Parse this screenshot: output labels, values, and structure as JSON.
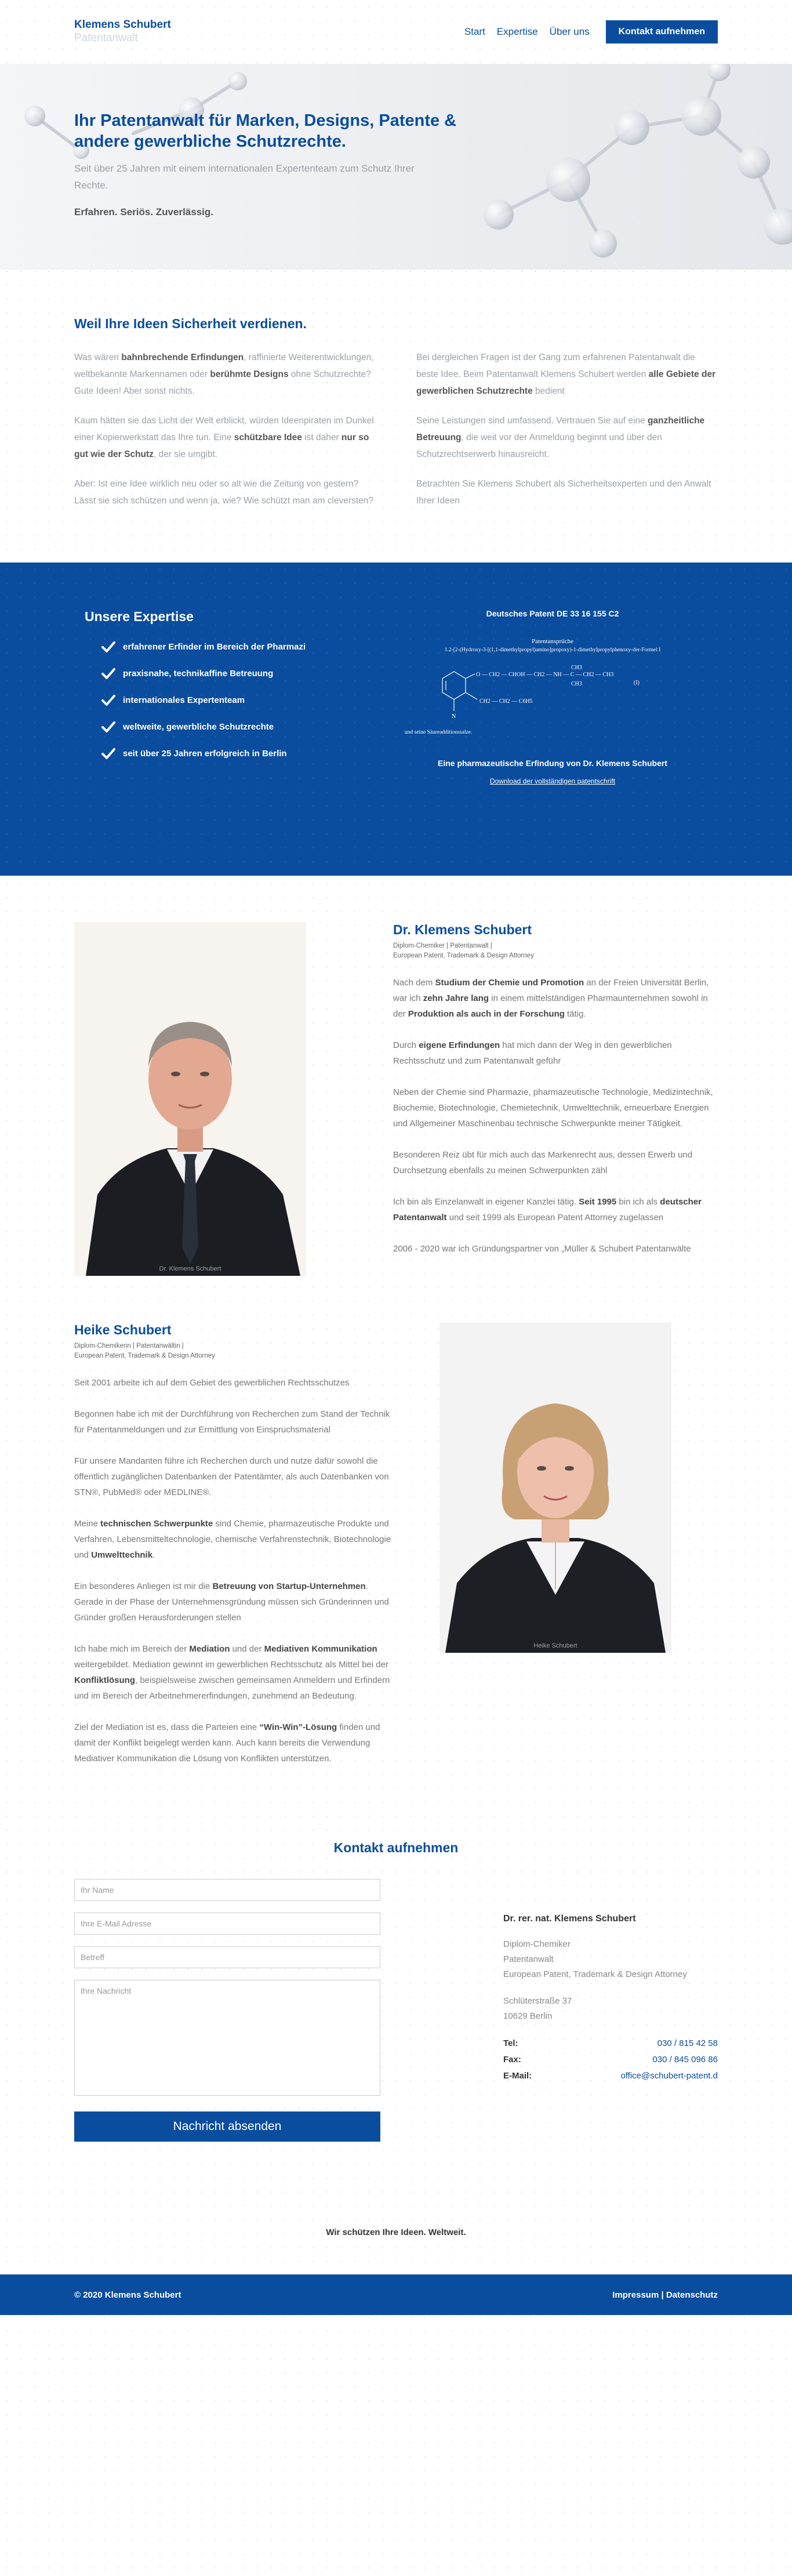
{
  "header": {
    "logo_name": "Klemens Schubert",
    "logo_sub": "Patentanwalt",
    "nav": [
      "Start",
      "Expertise",
      "Über uns"
    ],
    "cta": "Kontakt aufnehmen"
  },
  "hero": {
    "title": "Ihr Patentanwalt für Marken, Designs, Patente & andere gewerbliche Schutzrechte.",
    "lead": "Seit über 25 Jahren mit einem internationalen Expertenteam zum Schutz Ihrer Rechte.",
    "claim": "Erfahren. Seriös. Zuverlässig."
  },
  "intro": {
    "title": "Weil Ihre Ideen Sicherheit verdienen.",
    "left": [
      [
        "Was wären ",
        {
          "b": "bahnbrechende Erfindungen"
        },
        ", raffinierte Weiterentwicklungen, weltbekannte Markennamen oder ",
        {
          "b": "berühmte Designs"
        },
        " ohne Schutzrechte? Gute Ideen! Aber sonst nichts."
      ],
      [
        "Kaum hätten sie das Licht der Welt erblickt, würden Ideenpiraten im Dunkel einer Kopierwerkstatt das Ihre tun. Eine ",
        {
          "b": "schützbare Idee"
        },
        " ist daher ",
        {
          "b": "nur so gut wie der Schutz"
        },
        ", der sie umgibt."
      ],
      [
        "Aber: Ist eine Idee wirklich neu oder so alt wie die Zeitung von gestern? Lässt sie sich schützen und wenn ja, wie? Wie schützt man am cleversten?"
      ]
    ],
    "right": [
      [
        "Bei dergleichen Fragen ist der Gang zum erfahrenen Patentanwalt die beste Idee. Beim Patentanwalt Klemens Schubert werden ",
        {
          "b": "alle Gebiete der gewerblichen Schutzrechte"
        },
        " bedient"
      ],
      [
        "Seine Leistungen sind umfassend. Vertrauen Sie auf eine ",
        {
          "b": "ganzheitliche Betreuung"
        },
        ", die weit vor der Anmeldung beginnt und über den Schutzrechtserwerb hinausreicht."
      ],
      [
        "Betrachten Sie Klemens Schubert als Sicherheitsexperten und den Anwalt Ihrer Ideen"
      ]
    ]
  },
  "expertise": {
    "title": "Unsere Expertise",
    "items": [
      "erfahrener Erfinder im Bereich der Pharmazi",
      "praxisnahe, technikaffine Betreuung",
      "internationales Expertenteam",
      "weltweite, gewerbliche Schutzrechte",
      "seit über 25 Jahren erfolgreich in Berlin"
    ],
    "patent_title": "Deutsches Patent DE 33 16 155 C2",
    "patent_claims": "Patentansprüche",
    "patent_formula": "1.2-[2-(Hydroxy-3-[(1,1-dimethylpropyl)amino]propoxy)-1-dimethylpropylphenoxy-der-Formel I",
    "patent_sub": "und seine Säureadditionssalze.",
    "patent_caption": "Eine pharmazeutische Erfindung von Dr. Klemens Schubert",
    "patent_link": "Download der vollständigen patentschrift",
    "formula_labels": {
      "ch3a": "CH3",
      "chain": "O — CH2 — CHOH — CH2 — NH — C — CH2 — CH3",
      "ch3b": "CH3",
      "chain2": "CH2 — CH2 — C6H5",
      "roman": "(I)",
      "nlabel": "N"
    }
  },
  "klemens": {
    "name": "Dr. Klemens Schubert",
    "meta1": "Diplom-Chemiker | Patentanwalt |",
    "meta2": "European Patent, Trademark & Design Attorney",
    "photo_caption": "Dr. Klemens Schubert",
    "paras": [
      [
        "Nach dem ",
        {
          "b": "Studium der Chemie und Promotion"
        },
        " an der Freien Universität Berlin, war ich ",
        {
          "b": "zehn Jahre lang"
        },
        " in einem mittelständigen Pharmaunternehmen sowohl in der ",
        {
          "b": "Produktion als auch in der Forschung"
        },
        " tätig."
      ],
      [
        "Durch ",
        {
          "b": "eigene Erfindungen"
        },
        " hat mich dann der Weg in den gewerblichen Rechtsschutz und zum Patentanwalt geführ"
      ],
      [
        "Neben der Chemie sind Pharmazie, pharmazeutische Technologie, Medizintechnik, Biochemie, Biotechnologie, Chemietechnik, Umwelttechnik, erneuerbare Energien und Allgemeiner Maschinenbau technische Schwerpunkte meiner Tätigkeit."
      ],
      [
        "Besonderen Reiz übt für mich auch das Markenrecht aus, dessen Erwerb und Durchsetzung ebenfalls zu meinen Schwerpunkten zähl"
      ],
      [
        "Ich bin als Einzelanwalt in eigener Kanzlei tätig. ",
        {
          "b": "Seit 1995"
        },
        " bin ich als ",
        {
          "b": "deutscher Patentanwalt"
        },
        " und seit 1999 als European Patent Attorney zugelassen"
      ],
      [
        "2006 - 2020 war ich Gründungspartner von „Müller & Schubert Patentanwälte"
      ]
    ]
  },
  "heike": {
    "name": "Heike Schubert",
    "meta1": "Diplom-Chemikerin | Patentanwältin |",
    "meta2": "European Patent, Trademark & Design Attorney",
    "photo_caption": "Heike Schubert",
    "paras": [
      [
        "Seit 2001 arbeite ich auf dem Gebiet des gewerblichen Rechtsschutzes"
      ],
      [
        "Begonnen habe ich mit der Durchführung von Recherchen zum Stand der Technik für Patentanmeldungen und zur Ermittlung von Einspruchsmaterial"
      ],
      [
        "Für unsere Mandanten führe ich Recherchen durch und nutze dafür sowohl die öffentlich zugänglichen Datenbanken der Patentämter, als auch Datenbanken von STN®, PubMed® oder MEDLINE®."
      ],
      [
        "Meine ",
        {
          "b": "technischen Schwerpunkte"
        },
        " sind Chemie, pharmazeutische Produkte und Verfahren, Lebensmitteltechnologie, chemische Verfahrenstechnik, Biotechnologie und ",
        {
          "b": "Umwelttechnik"
        },
        "."
      ],
      [
        "Ein besonderes Anliegen ist mir die ",
        {
          "b": "Betreuung von Startup-Unternehmen"
        },
        ". Gerade in der Phase der Unternehmensgründung müssen sich Gründerinnen und Gründer großen Herausforderungen stellen"
      ],
      [
        "Ich habe mich im Bereich der ",
        {
          "b": "Mediation"
        },
        " und der ",
        {
          "b": "Mediativen Kommunikation"
        },
        " weitergebildet. Mediation gewinnt im gewerblichen Rechtsschutz als Mittel bei der ",
        {
          "b": "Konfliktlösung"
        },
        ", beispielsweise zwischen gemeinsamen Anmeldern und Erfindern und im Bereich der Arbeitnehmererfindungen, zunehmend an Bedeutung."
      ],
      [
        "Ziel der Mediation ist es, dass die Parteien eine ",
        {
          "b": "“Win-Win”-Lösung"
        },
        " finden und damit der Konflikt beigelegt werden kann. Auch kann bereits die Verwendung Mediativer Kommunikation die Lösung von Konflikten unterstützen."
      ]
    ]
  },
  "contact": {
    "title": "Kontakt aufnehmen",
    "placeholders": {
      "name": "Ihr Name",
      "email": "Ihre E-Mail Adresse",
      "subject": "Betreff",
      "message": "Ihre Nachricht"
    },
    "send": "Nachricht absenden",
    "info_name": "Dr. rer. nat. Klemens Schubert",
    "info_lines": [
      "Diplom-Chemiker",
      "Patentanwalt",
      "European Patent, Trademark & Design Attorney"
    ],
    "street": "Schlüterstraße 37",
    "city": "10629 Berlin",
    "tel_label": "Tel:",
    "tel": "030 / 815 42 58",
    "fax_label": "Fax:",
    "fax": "030 / 845 096 86",
    "mail_label": "E-Mail:",
    "mail": "office@schubert-patent.d"
  },
  "slogan": "Wir schützen Ihre Ideen. Weltweit.",
  "footer": {
    "copyright": "© 2020 Klemens Schubert",
    "links": "Impressum | Datenschutz"
  },
  "colors": {
    "brand_blue": "#0a4d9e",
    "text_grey": "#9aa0a8"
  }
}
